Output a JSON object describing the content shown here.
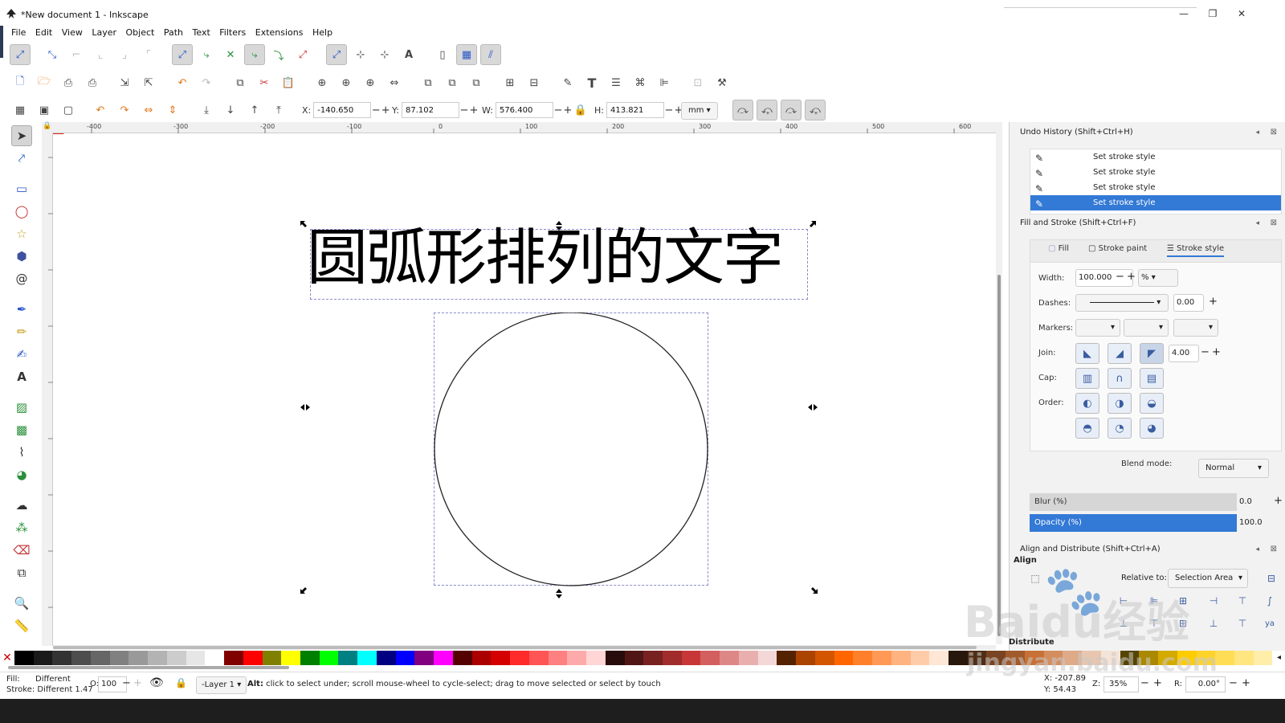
{
  "window": {
    "title": "*New document 1 - Inkscape",
    "controls": [
      "—",
      "❐",
      "✕"
    ]
  },
  "menu": [
    "File",
    "Edit",
    "View",
    "Layer",
    "Object",
    "Path",
    "Text",
    "Filters",
    "Extensions",
    "Help"
  ],
  "transform": {
    "x_label": "X:",
    "x_value": "-140.650",
    "y_label": "Y:",
    "y_value": "87.102",
    "w_label": "W:",
    "w_value": "576.400",
    "h_label": "H:",
    "h_value": "413.821",
    "unit": "mm"
  },
  "ruler": {
    "ticks": [
      "-400",
      "-300",
      "-200",
      "-100",
      "0",
      "100",
      "200",
      "300",
      "400",
      "500",
      "600"
    ]
  },
  "canvas": {
    "text": "圆弧形排列的文字"
  },
  "undo_history": {
    "title": "Undo History (Shift+Ctrl+H)",
    "items": [
      "Set stroke style",
      "Set stroke style",
      "Set stroke style",
      "Set stroke style"
    ]
  },
  "fill_stroke": {
    "title": "Fill and Stroke (Shift+Ctrl+F)",
    "tabs": [
      "Fill",
      "Stroke paint",
      "Stroke style"
    ],
    "width_label": "Width:",
    "width_value": "100.000",
    "width_unit": "%",
    "dashes_label": "Dashes:",
    "dashes_value": "0.00",
    "markers_label": "Markers:",
    "join_label": "Join:",
    "join_value": "4.00",
    "cap_label": "Cap:",
    "order_label": "Order:",
    "blend_label": "Blend mode:",
    "blend_value": "Normal",
    "blur_label": "Blur (%)",
    "blur_value": "0.0",
    "opacity_label": "Opacity (%)",
    "opacity_value": "100.0"
  },
  "align": {
    "title": "Align and Distribute (Shift+Ctrl+A)",
    "section": "Align",
    "relative_label": "Relative to:",
    "relative_value": "Selection Area",
    "distribute": "Distribute"
  },
  "status": {
    "fill_label": "Fill:",
    "fill_value": "Different",
    "stroke_text": "Stroke: Different 1.47",
    "opacity_label": "O:",
    "opacity_value": "100",
    "layer": "-Layer 1",
    "message_bold": "Alt:",
    "message": " click to select under; scroll mouse-wheel to cycle-select; drag to move selected or select by touch",
    "cursor_x": "X: -207.89",
    "cursor_y": "Y:   54.43",
    "zoom_label": "Z:",
    "zoom_value": "35%",
    "rotate_label": "R:",
    "rotate_value": "0.00°"
  },
  "watermark": {
    "logo": "Baidu经验",
    "url": "jingyan.baidu.com"
  },
  "colors": {
    "selection_blue": "#3379d6",
    "arrow_red": "#e0201b"
  }
}
